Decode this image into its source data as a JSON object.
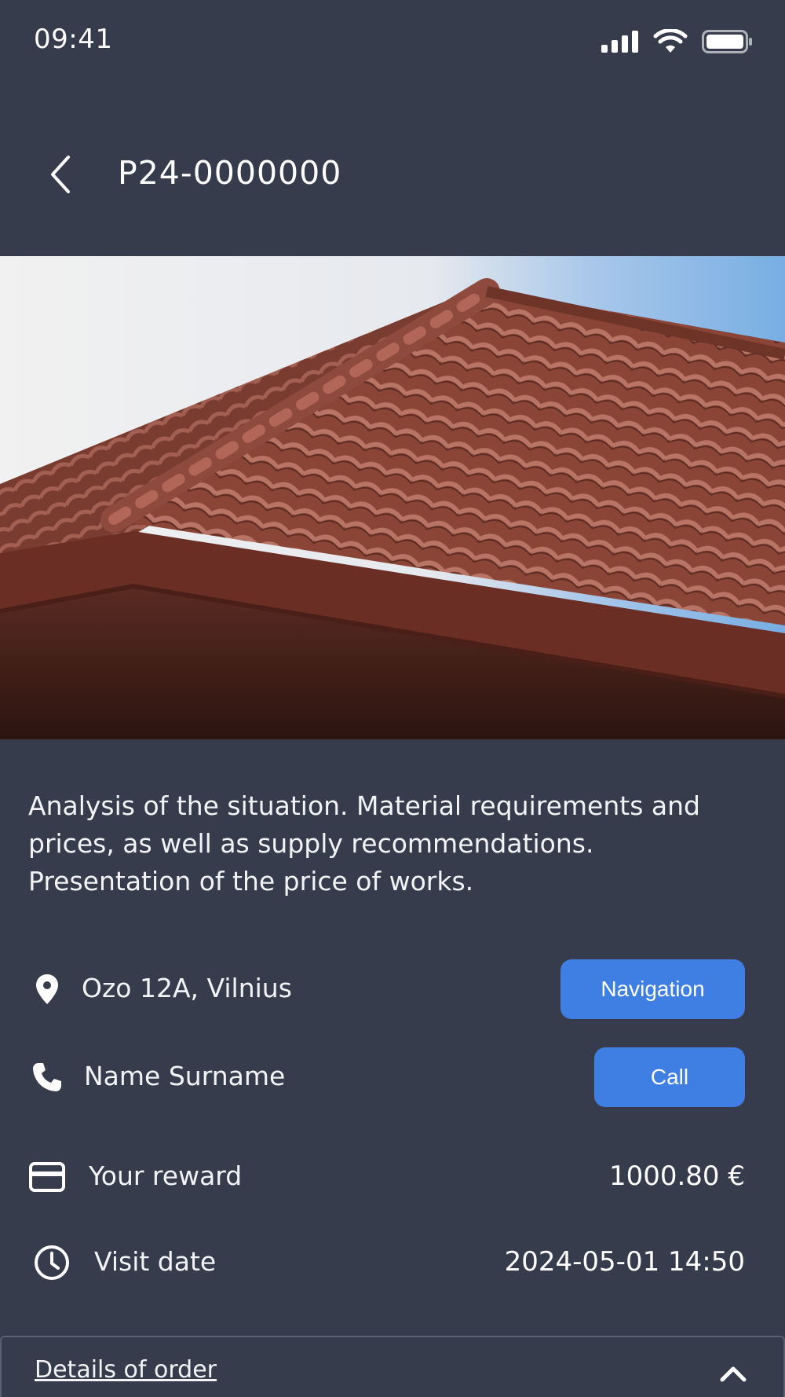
{
  "status_bar": {
    "time": "09:41",
    "icons": [
      "signal-icon",
      "wifi-icon",
      "battery-icon"
    ]
  },
  "header": {
    "title": "P24-0000000",
    "back_icon": "chevron-left-icon"
  },
  "hero_image": {
    "subject": "roof-tiles-photo"
  },
  "description": "Analysis of the situation. Material requirements and prices, as well as supply recommendations. Presentation of the price of works.",
  "info": {
    "address": {
      "icon": "location-pin-icon",
      "text": "Ozo 12A, Vilnius",
      "button_label": "Navigation"
    },
    "contact": {
      "icon": "phone-icon",
      "text": "Name Surname",
      "button_label": "Call"
    },
    "reward": {
      "icon": "credit-card-icon",
      "label": "Your reward",
      "value": "1000.80 €"
    },
    "visit": {
      "icon": "clock-icon",
      "label": "Visit date",
      "value": "2024-05-01 14:50"
    }
  },
  "details": {
    "label": "Details of order",
    "icon": "chevron-up-icon"
  },
  "colors": {
    "background": "#363c4b",
    "accent": "#3f7ee3",
    "text": "#ffffff"
  }
}
